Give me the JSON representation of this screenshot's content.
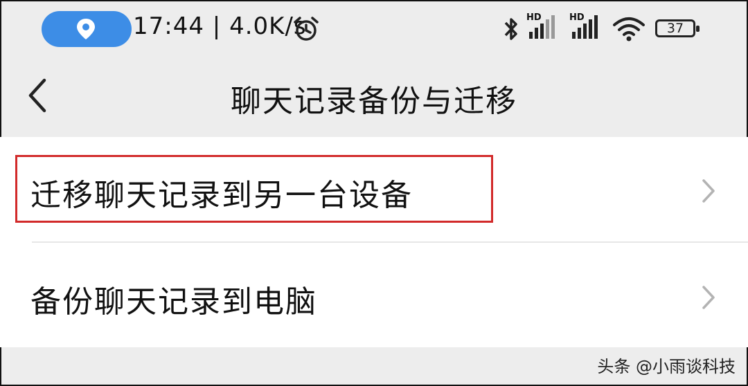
{
  "status_bar": {
    "time": "17:44",
    "separator": "|",
    "speed": "4.0K/s",
    "hd_label_1": "HD",
    "hd_label_2": "HD",
    "battery_level": "37",
    "icons": [
      "location-pin-icon",
      "alarm-icon",
      "bluetooth-icon",
      "signal-icon",
      "signal-icon",
      "wifi-icon",
      "battery-icon"
    ]
  },
  "nav": {
    "title": "聊天记录备份与迁移",
    "back_icon": "chevron-left-icon"
  },
  "list": {
    "items": [
      {
        "label": "迁移聊天记录到另一台设备",
        "icon": "chevron-right-icon"
      },
      {
        "label": "备份聊天记录到电脑",
        "icon": "chevron-right-icon"
      }
    ]
  },
  "watermark": "头条 @小雨谈科技",
  "colors": {
    "background": "#ededed",
    "list_background": "#ffffff",
    "location_pill": "#3d8de6",
    "highlight_border": "#d22a2a",
    "chevron": "#b3b3b3"
  }
}
